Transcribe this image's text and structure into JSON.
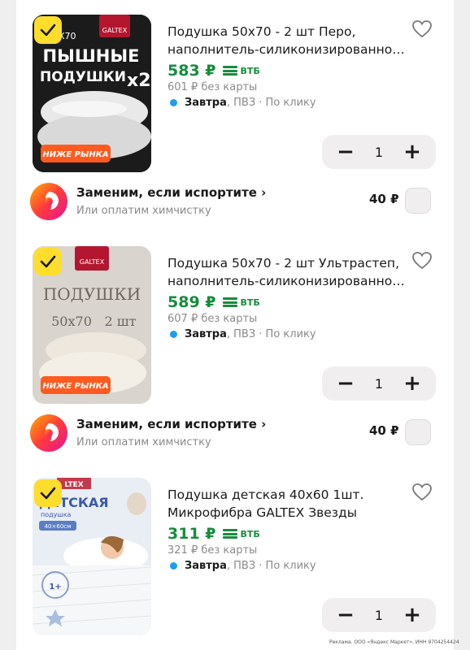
{
  "products": [
    {
      "title_line1": "Подушка 50х70 - 2 шт Перо,",
      "title_line2": "наполнитель-силиконизированно…",
      "price": "583 ₽",
      "bank": "ВТБ",
      "old_price": "601 ₽ без карты",
      "delivery_day": "Завтра",
      "delivery_rest": ", ПВЗ · По клику",
      "quantity": "1",
      "image": {
        "brand": "GALTEX",
        "corner": "X70",
        "line1": "ПЫШНЫЕ",
        "line2": "ПОДУШКИ",
        "mult": "x2",
        "badge": "НИЖЕ РЫНКА"
      }
    },
    {
      "title_line1": "Подушка 50х70 - 2 шт Ультрастеп,",
      "title_line2": "наполнитель-силиконизированно…",
      "price": "589 ₽",
      "bank": "ВТБ",
      "old_price": "607 ₽ без карты",
      "delivery_day": "Завтра",
      "delivery_rest": ", ПВЗ · По клику",
      "quantity": "1",
      "image": {
        "brand": "GALTEX",
        "line1": "ПОДУШКИ",
        "size": "50x70",
        "count": "2 шт",
        "badge": "НИЖЕ РЫНКА"
      }
    },
    {
      "title_line1": "Подушка детская 40х60 1шт.",
      "title_line2": "Микрофибра GALTEX Звезды",
      "price": "311 ₽",
      "bank": "ВТБ",
      "old_price": "321 ₽ без карты",
      "delivery_day": "Завтра",
      "delivery_rest": ", ПВЗ · По клику",
      "quantity": "1",
      "image": {
        "brand": "LTEX",
        "line1": "ДЕТСКАЯ",
        "line2": "подушка",
        "size": "40×60см",
        "age": "1+"
      }
    }
  ],
  "service": {
    "title": "Заменим, если испортите",
    "subtitle": "Или оплатим химчистку",
    "price": "40 ₽"
  },
  "stepper": {
    "minus": "−",
    "plus": "+"
  },
  "footer": "Реклама. ООО «Яндекс Маркет», ИНН 9704254424",
  "colors": {
    "price_green": "#178c3c",
    "checkbox_yellow": "#ffdd2d",
    "delivery_dot": "#1c9ef0",
    "badge_orange": "#ff5a1f"
  }
}
